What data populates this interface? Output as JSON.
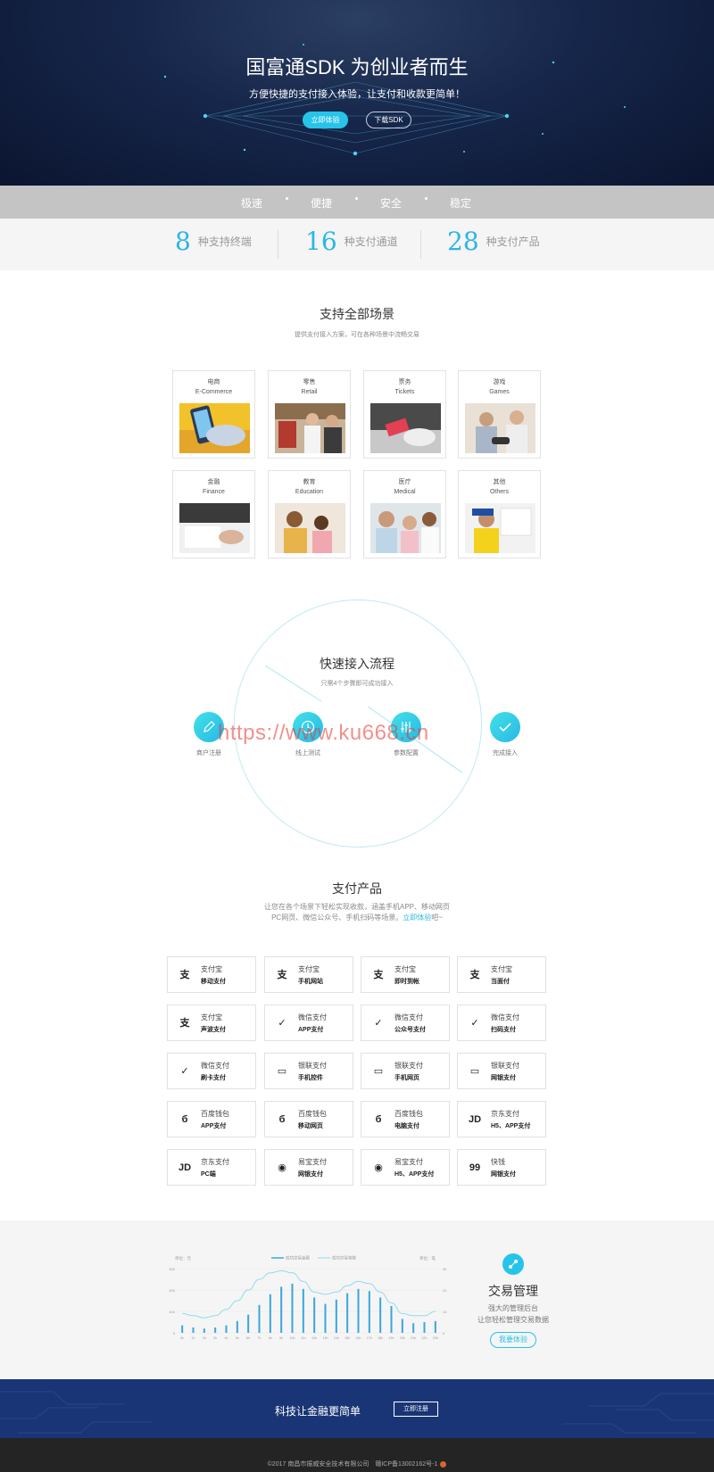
{
  "hero": {
    "title": "国富通SDK 为创业者而生",
    "subtitle": "方便快捷的支付接入体验，让支付和收款更简单！",
    "btn_primary": "立即体验",
    "btn_secondary": "下载SDK"
  },
  "features": [
    "极速",
    "便捷",
    "安全",
    "稳定"
  ],
  "stats": [
    {
      "num": "8",
      "label": "种支持终端"
    },
    {
      "num": "16",
      "label": "种支付通道"
    },
    {
      "num": "28",
      "label": "种支付产品"
    }
  ],
  "scenes": {
    "title": "支持全部场景",
    "subtitle": "提供支付接入方案，可在各种场景中流畅交易",
    "items": [
      {
        "cn": "电商",
        "en": "E-Commerce"
      },
      {
        "cn": "零售",
        "en": "Retail"
      },
      {
        "cn": "票务",
        "en": "Tickets"
      },
      {
        "cn": "游戏",
        "en": "Games"
      },
      {
        "cn": "金融",
        "en": "Finance"
      },
      {
        "cn": "教育",
        "en": "Education"
      },
      {
        "cn": "医疗",
        "en": "Medical"
      },
      {
        "cn": "其他",
        "en": "Others"
      }
    ]
  },
  "flow": {
    "title": "快速接入流程",
    "subtitle": "只需4个步骤即可成功接入",
    "steps": [
      {
        "label": "商户注册",
        "icon": "pencil-icon"
      },
      {
        "label": "线上测试",
        "icon": "clock-icon"
      },
      {
        "label": "参数配置",
        "icon": "sliders-icon"
      },
      {
        "label": "完成接入",
        "icon": "check-icon"
      }
    ],
    "watermark": "https://www.ku668.cn"
  },
  "products": {
    "title": "支付产品",
    "desc_line1": "让您在各个场景下轻松实现收款，涵盖手机APP、移动网页",
    "desc_line2_prefix": "PC网页、微信公众号、手机扫码等场景。",
    "desc_link": "立即体验",
    "desc_suffix": "吧~",
    "items": [
      {
        "name": "支付宝",
        "type": "移动支付",
        "icon": "支"
      },
      {
        "name": "支付宝",
        "type": "手机网站",
        "icon": "支"
      },
      {
        "name": "支付宝",
        "type": "即时到帐",
        "icon": "支"
      },
      {
        "name": "支付宝",
        "type": "当面付",
        "icon": "支"
      },
      {
        "name": "支付宝",
        "type": "声波支付",
        "icon": "支"
      },
      {
        "name": "微信支付",
        "type": "APP支付",
        "icon": "✓"
      },
      {
        "name": "微信支付",
        "type": "公众号支付",
        "icon": "✓"
      },
      {
        "name": "微信支付",
        "type": "扫码支付",
        "icon": "✓"
      },
      {
        "name": "微信支付",
        "type": "刷卡支付",
        "icon": "✓"
      },
      {
        "name": "银联支付",
        "type": "手机控件",
        "icon": "▭"
      },
      {
        "name": "银联支付",
        "type": "手机网页",
        "icon": "▭"
      },
      {
        "name": "银联支付",
        "type": "网银支付",
        "icon": "▭"
      },
      {
        "name": "百度钱包",
        "type": "APP支付",
        "icon": "б"
      },
      {
        "name": "百度钱包",
        "type": "移动网页",
        "icon": "б"
      },
      {
        "name": "百度钱包",
        "type": "电脑支付",
        "icon": "б"
      },
      {
        "name": "京东支付",
        "type": "H5、APP支付",
        "icon": "JD"
      },
      {
        "name": "京东支付",
        "type": "PC端",
        "icon": "JD"
      },
      {
        "name": "易宝支付",
        "type": "网银支付",
        "icon": "◉"
      },
      {
        "name": "易宝支付",
        "type": "H5、APP支付",
        "icon": "◉"
      },
      {
        "name": "快钱",
        "type": "网银支付",
        "icon": "99"
      }
    ]
  },
  "trade": {
    "title": "交易管理",
    "line1": "强大的管理后台",
    "line2": "让您轻松管理交易数据",
    "btn": "我要体验"
  },
  "chart_data": {
    "type": "bar",
    "left_unit": "单位：元",
    "right_unit": "单位：笔",
    "legend": [
      "成功交易金额",
      "成功交易笔数"
    ],
    "categories": [
      "0h",
      "1h",
      "2h",
      "3h",
      "4h",
      "5h",
      "6h",
      "7h",
      "8h",
      "9h",
      "10h",
      "11h",
      "12h",
      "13h",
      "14h",
      "15h",
      "16h",
      "17h",
      "18h",
      "19h",
      "20h",
      "21h",
      "22h",
      "23h"
    ],
    "y_ticks": [
      "0",
      "100",
      "200",
      "300"
    ],
    "y_right_ticks": [
      "0",
      "10",
      "20",
      "30"
    ],
    "ylim": [
      0,
      300
    ],
    "series": [
      {
        "name": "成功交易金额",
        "type": "bar",
        "values": [
          35,
          25,
          20,
          25,
          35,
          55,
          85,
          130,
          180,
          215,
          230,
          205,
          165,
          135,
          155,
          185,
          205,
          195,
          165,
          125,
          65,
          45,
          50,
          55
        ]
      },
      {
        "name": "成功交易笔数",
        "type": "line",
        "values": [
          9,
          8,
          7,
          8,
          11,
          15,
          20,
          25,
          28,
          29,
          28,
          24,
          19,
          18,
          19,
          22,
          24,
          23,
          19,
          14,
          9,
          8,
          8,
          10
        ]
      }
    ],
    "colors": {
      "bar": "#3aa6dd",
      "line": "#8fdcef"
    }
  },
  "cta": {
    "text": "科技让金融更简单",
    "btn": "立即注册"
  },
  "footer": {
    "text": "©2017 南昌市振威安全技术有限公司　赣ICP备13002162号-1"
  }
}
